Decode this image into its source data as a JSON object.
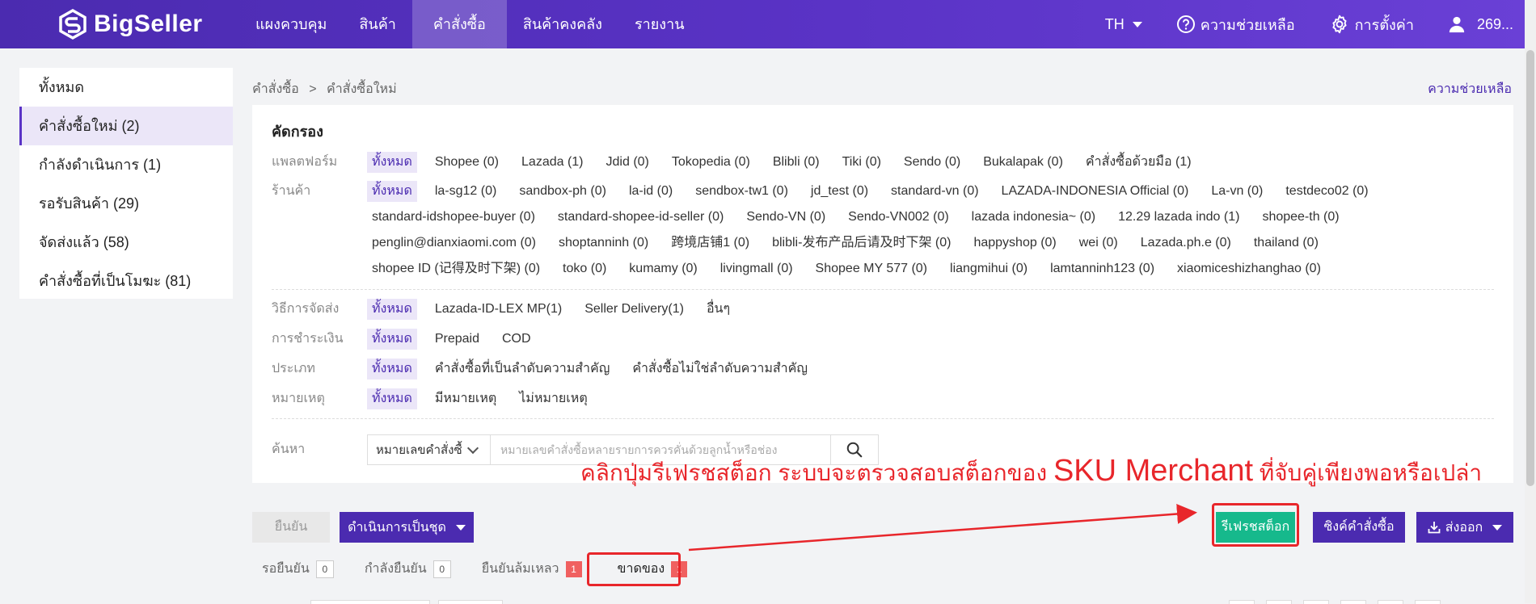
{
  "app": {
    "logo_text": "BigSeller"
  },
  "nav": {
    "items": [
      "แผงควบคุม",
      "สินค้า",
      "คำสั่งซื้อ",
      "สินค้าคงคลัง",
      "รายงาน"
    ],
    "lang": "TH",
    "help": "ความช่วยเหลือ",
    "settings": "การตั้งค่า",
    "user": "269..."
  },
  "sidebar": {
    "items": [
      {
        "label": "ทั้งหมด"
      },
      {
        "label": "คำสั่งซื้อใหม่ (2)"
      },
      {
        "label": "กำลังดำเนินการ (1)"
      },
      {
        "label": "รอรับสินค้า (29)"
      },
      {
        "label": "จัดส่งแล้ว (58)"
      },
      {
        "label": "คำสั่งซื้อที่เป็นโมฆะ (81)"
      }
    ]
  },
  "breadcrumb": {
    "root": "คำสั่งซื้อ",
    "sep": ">",
    "current": "คำสั่งซื้อใหม่",
    "help": "ความช่วยเหลือ"
  },
  "filter": {
    "title": "คัดกรอง",
    "platform": {
      "label": "แพลตฟอร์ม",
      "options": [
        "ทั้งหมด",
        "Shopee (0)",
        "Lazada (1)",
        "Jdid (0)",
        "Tokopedia (0)",
        "Blibli (0)",
        "Tiki (0)",
        "Sendo (0)",
        "Bukalapak (0)",
        "คำสั่งซื้อด้วยมือ (1)"
      ]
    },
    "store": {
      "label": "ร้านค้า",
      "rows": [
        [
          "ทั้งหมด",
          "la-sg12 (0)",
          "sandbox-ph (0)",
          "la-id (0)",
          "sendbox-tw1 (0)",
          "jd_test (0)",
          "standard-vn (0)",
          "LAZADA-INDONESIA Official (0)",
          "La-vn (0)",
          "testdeco02 (0)"
        ],
        [
          "standard-idshopee-buyer (0)",
          "standard-shopee-id-seller (0)",
          "Sendo-VN (0)",
          "Sendo-VN002 (0)",
          "lazada indonesia~ (0)",
          "12.29 lazada indo (1)",
          "shopee-th (0)"
        ],
        [
          "penglin@dianxiaomi.com (0)",
          "shoptanninh (0)",
          "跨境店铺1 (0)",
          "blibli-发布产品后请及时下架 (0)",
          "happyshop (0)",
          "wei (0)",
          "Lazada.ph.e (0)",
          "thailand (0)"
        ],
        [
          "shopee ID (记得及时下架)  (0)",
          "toko (0)",
          "kumamy (0)",
          "livingmall (0)",
          "Shopee MY 577 (0)",
          "liangmihui (0)",
          "lamtanninh123 (0)",
          "xiaomiceshizhanghao (0)"
        ]
      ]
    },
    "shipping": {
      "label": "วิธีการจัดส่ง",
      "options": [
        "ทั้งหมด",
        "Lazada-ID-LEX MP(1)",
        "Seller Delivery(1)",
        "อื่นๆ"
      ]
    },
    "payment": {
      "label": "การชำระเงิน",
      "options": [
        "ทั้งหมด",
        "Prepaid",
        "COD"
      ]
    },
    "type": {
      "label": "ประเภท",
      "options": [
        "ทั้งหมด",
        "คำสั่งซื้อที่เป็นลำดับความสำคัญ",
        "คำสั่งซื้อไม่ใช่ลำดับความสำคัญ"
      ]
    },
    "note": {
      "label": "หมายเหตุ",
      "options": [
        "ทั้งหมด",
        "มีหมายเหตุ",
        "ไม่หมายเหตุ"
      ]
    },
    "search": {
      "label": "ค้นหา",
      "field": "หมายเลขคำสั่งซื้",
      "placeholder": "หมายเลขคำสั่งซื้อหลายรายการควรคั่นด้วยลูกน้ำหรือช่อง"
    }
  },
  "annotation": {
    "part1": "คลิกปุ่มรีเฟรชสต็อก  ระบบจะตรวจสอบสต็อกของ ",
    "part2": "SKU Merchant",
    "part3": " ที่จับคู่เพียงพอหรือเปล่า"
  },
  "actions": {
    "confirm": "ยืนยัน",
    "batch": "ดำเนินการเป็นชุด",
    "refresh_stock": "รีเฟรชสต็อก",
    "sync": "ซิงค์คำสั่งซื้อ",
    "export": "ส่งออก"
  },
  "subtabs": [
    {
      "label": "รอยืนยัน",
      "count": "0"
    },
    {
      "label": "กำลังยืนยัน",
      "count": "0"
    },
    {
      "label": "ยืนยันล้มเหลว",
      "count": "1"
    },
    {
      "label": "ขาดของ",
      "count": "1"
    }
  ],
  "colors": {
    "brand": "#4b2bb0",
    "refresh": "#16b98c",
    "annotation": "#e8262b"
  }
}
